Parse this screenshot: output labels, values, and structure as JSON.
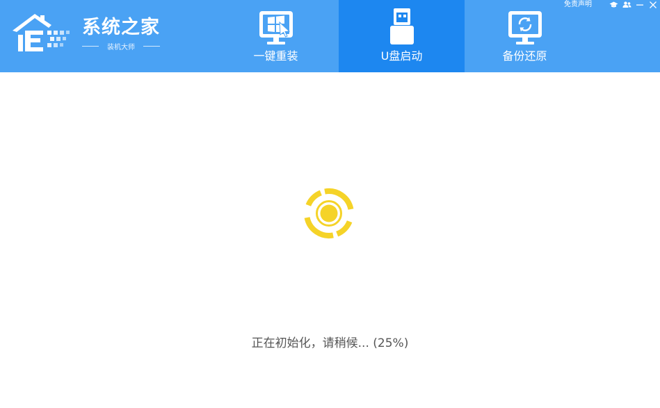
{
  "brand": {
    "title": "系统之家",
    "subtitle": "装机大师"
  },
  "tabs": [
    {
      "label": "一键重装",
      "icon": "windows-monitor-icon",
      "active": false
    },
    {
      "label": "U盘启动",
      "icon": "usb-drive-icon",
      "active": true
    },
    {
      "label": "备份还原",
      "icon": "backup-restore-icon",
      "active": false
    }
  ],
  "window_controls": {
    "disclaimer": "免责声明",
    "icons": [
      "graduation-cap-icon",
      "users-icon",
      "minimize-icon",
      "close-icon"
    ]
  },
  "status": {
    "text": "正在初始化，请稍候... (25%)",
    "progress_percent": 25
  },
  "colors": {
    "header_bg": "#4aa2f4",
    "active_tab_bg": "#1d87f0",
    "loader": "#f5d328",
    "text": "#555555"
  }
}
